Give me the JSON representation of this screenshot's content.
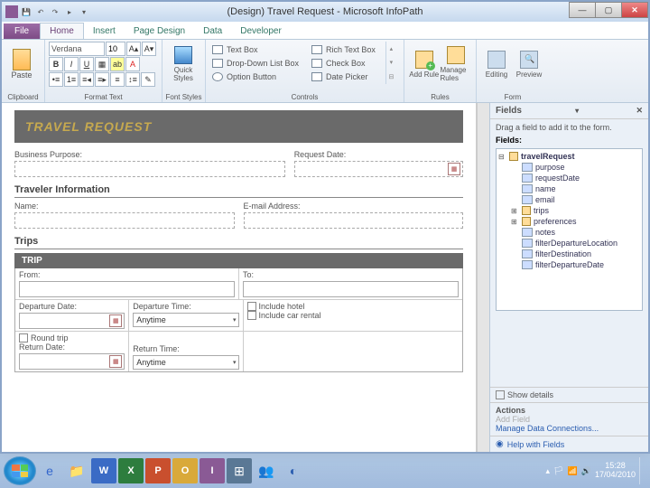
{
  "title": "(Design) Travel Request - Microsoft InfoPath",
  "tabs": {
    "file": "File",
    "home": "Home",
    "insert": "Insert",
    "page": "Page Design",
    "data": "Data",
    "dev": "Developer"
  },
  "ribbon": {
    "paste": "Paste",
    "font_name": "Verdana",
    "font_size": "10",
    "groups": {
      "clipboard": "Clipboard",
      "format": "Format Text",
      "fontstyles": "Font Styles",
      "controls": "Controls",
      "rules": "Rules",
      "form": "Form"
    },
    "quick": "Quick Styles",
    "ctrls": {
      "textbox": "Text Box",
      "richtext": "Rich Text Box",
      "dropdown": "Drop-Down List Box",
      "checkbox": "Check Box",
      "option": "Option Button",
      "datepicker": "Date Picker"
    },
    "addrule": "Add Rule",
    "manage": "Manage Rules",
    "editing": "Editing",
    "preview": "Preview"
  },
  "form": {
    "header": "TRAVEL REQUEST",
    "purpose": "Business Purpose:",
    "reqdate": "Request Date:",
    "traveler_sec": "Traveler Information",
    "name": "Name:",
    "email": "E-mail Address:",
    "trips_sec": "Trips",
    "trip": "TRIP",
    "from": "From:",
    "to": "To:",
    "depdate": "Departure Date:",
    "deptime": "Departure Time:",
    "retdate": "Return Date:",
    "rettime": "Return Time:",
    "anytime": "Anytime",
    "round": "Round trip",
    "hotel": "Include hotel",
    "car": "Include car rental"
  },
  "side": {
    "title": "Fields",
    "hint": "Drag a field to add it to the form.",
    "label": "Fields:",
    "root": "travelRequest",
    "items": [
      "purpose",
      "requestDate",
      "name",
      "email",
      "trips",
      "preferences",
      "notes",
      "filterDepartureLocation",
      "filterDestination",
      "filterDepartureDate"
    ],
    "show": "Show details",
    "actions": "Actions",
    "addfield": "Add Field",
    "manage": "Manage Data Connections...",
    "help": "Help with Fields"
  },
  "tray": {
    "time": "15:28",
    "date": "17/04/2010"
  }
}
